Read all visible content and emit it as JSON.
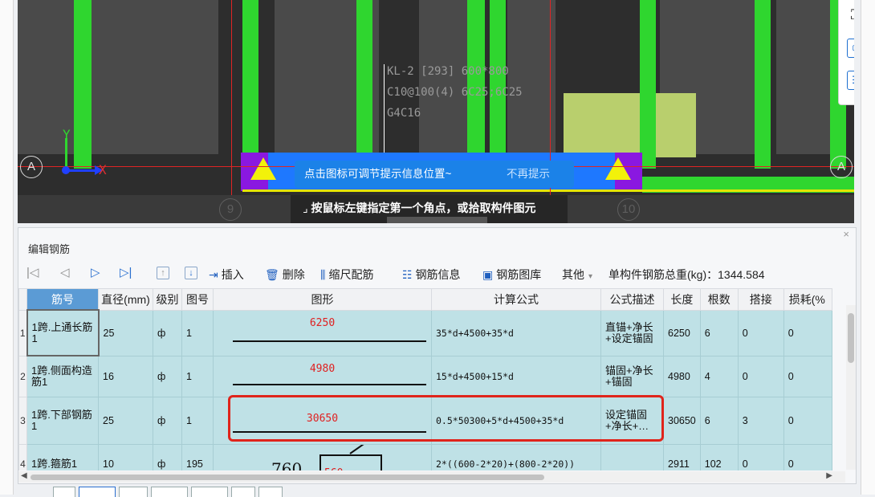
{
  "viewport": {
    "member_label": [
      "KL-2 [293] 600*800",
      "C10@100(4) 6C25;6C25",
      "G4C16"
    ],
    "axis_y_label": "Y",
    "axis_x_label": "X",
    "axis_left": "A",
    "axis_right": "A",
    "axis_9": "9",
    "axis_10": "10",
    "hint_message": "点击图标可调节提示信息位置~",
    "hint_dismiss": "不再提示",
    "status_text": "按鼠标左键指定第一个角点，或拾取构件图元"
  },
  "panel": {
    "title": "编辑钢筋",
    "toolbar": {
      "insert": "插入",
      "delete": "删除",
      "scale_rebar": "缩尺配筋",
      "rebar_info": "钢筋信息",
      "rebar_library": "钢筋图库",
      "other": "其他",
      "total_weight_label": "单构件钢筋总重(kg)：",
      "total_weight_value": "1344.584"
    },
    "columns": [
      "筋号",
      "直径(mm)",
      "级别",
      "图号",
      "图形",
      "计算公式",
      "公式描述",
      "长度",
      "根数",
      "搭接",
      "损耗(%"
    ],
    "rows": [
      {
        "num": "1",
        "name": "1跨.上通长筋1",
        "dia": "25",
        "grade": "ф",
        "fig_no": "1",
        "shape": "6250",
        "formula": "35*d+4500+35*d",
        "desc": "直锚+净长+设定锚固",
        "length": "6250",
        "count": "6",
        "lap": "0",
        "loss": "0"
      },
      {
        "num": "2",
        "name": "1跨.侧面构造筋1",
        "dia": "16",
        "grade": "ф",
        "fig_no": "1",
        "shape": "4980",
        "formula": "15*d+4500+15*d",
        "desc": "锚固+净长+锚固",
        "length": "4980",
        "count": "4",
        "lap": "0",
        "loss": "0"
      },
      {
        "num": "3",
        "name": "1跨.下部钢筋1",
        "dia": "25",
        "grade": "ф",
        "fig_no": "1",
        "shape": "30650",
        "formula": "0.5*50300+5*d+4500+35*d",
        "desc": "设定锚固+净长+…",
        "length": "30650",
        "count": "6",
        "lap": "3",
        "loss": "0"
      },
      {
        "num": "4",
        "name": "1跨.箍筋1",
        "dia": "10",
        "grade": "ф",
        "fig_no": "195",
        "shape": "760",
        "shape2": "560",
        "formula": "2*((600-2*20)+(800-2*20))",
        "desc": "",
        "length": "2911",
        "count": "102",
        "lap": "0",
        "loss": "0"
      }
    ]
  }
}
